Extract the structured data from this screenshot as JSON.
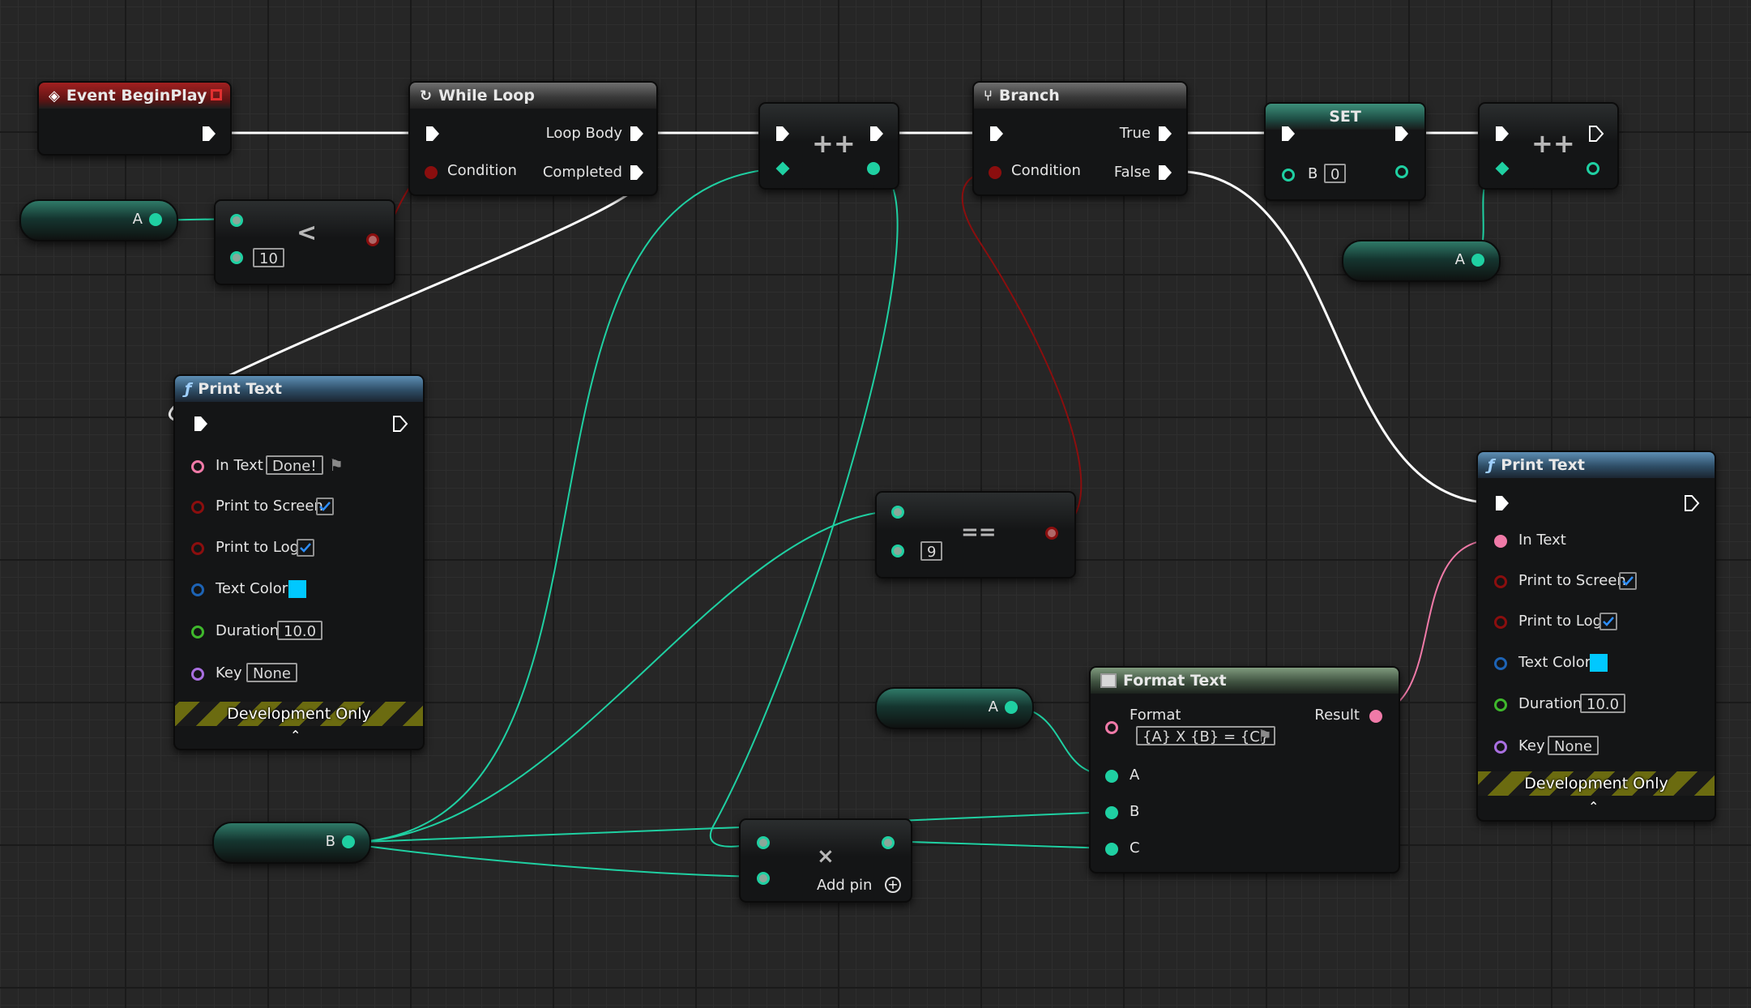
{
  "nodes": {
    "event_begin_play": {
      "title": "Event BeginPlay"
    },
    "while_loop": {
      "title": "While Loop",
      "loop_body": "Loop Body",
      "condition": "Condition",
      "completed": "Completed"
    },
    "less_than": {
      "operator": "<",
      "value": "10"
    },
    "var_a_1": {
      "name": "A"
    },
    "var_a_2": {
      "name": "A"
    },
    "var_a_3": {
      "name": "A"
    },
    "var_b": {
      "name": "B"
    },
    "increment_1": {
      "operator": "++"
    },
    "increment_2": {
      "operator": "++"
    },
    "branch": {
      "title": "Branch",
      "true_label": "True",
      "false_label": "False",
      "condition": "Condition"
    },
    "set_b": {
      "title": "SET",
      "var_label": "B",
      "value": "0"
    },
    "equals": {
      "operator": "==",
      "value": "9"
    },
    "multiply": {
      "operator": "×",
      "add_pin": "Add pin"
    },
    "format_text": {
      "title": "Format Text",
      "format_label": "Format",
      "format_value": "{A} X {B} = {C}",
      "result": "Result",
      "pin_a": "A",
      "pin_b": "B",
      "pin_c": "C"
    },
    "print_text_1": {
      "title": "Print Text",
      "in_text": "In Text",
      "in_text_value": "Done!",
      "print_to_screen": "Print to Screen",
      "print_to_log": "Print to Log",
      "text_color": "Text Color",
      "duration": "Duration",
      "duration_value": "10.0",
      "key": "Key",
      "key_value": "None",
      "dev_only": "Development Only"
    },
    "print_text_2": {
      "title": "Print Text",
      "in_text": "In Text",
      "print_to_screen": "Print to Screen",
      "print_to_log": "Print to Log",
      "text_color": "Text Color",
      "duration": "Duration",
      "duration_value": "10.0",
      "key": "Key",
      "key_value": "None",
      "dev_only": "Development Only"
    }
  },
  "colors": {
    "exec_wire": "#ffffff",
    "int_wire": "#1fd0a2",
    "bool_wire": "#8b0e0e",
    "text_wire": "#f07aa8",
    "text_color_swatch": "#00c8ff"
  }
}
